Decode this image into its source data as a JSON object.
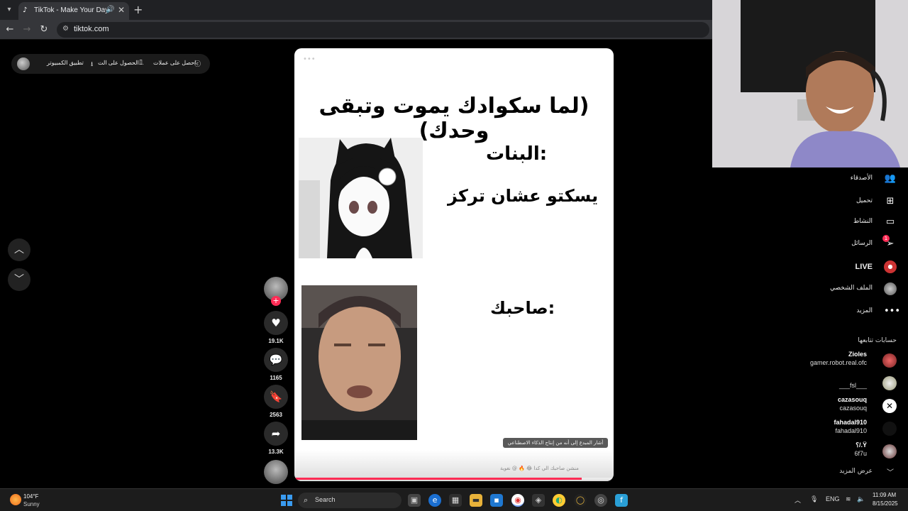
{
  "browser": {
    "tab_title": "TikTok - Make Your Day",
    "url": "tiktok.com"
  },
  "top_bar": {
    "get_coins": "احصل على عملات",
    "get_app": "الحصول على الت...",
    "desktop_app": "تطبيق الكمبيوتر"
  },
  "video": {
    "meme_title": "(لما سكوادك يموت وتبقى وحدك)",
    "girls_label": "البنات:",
    "girls_text": "يسكتو عشان تركز",
    "friend_label": "صاحبك:",
    "ai_notice": "أشار المبدع إلى أنه من إنتاج الذكاء الاصطناعي",
    "caption": "منشن صاحبك الي كدا 😂 🔥 @ نغوية",
    "progress": 0.9
  },
  "actions": {
    "likes": "19.1K",
    "comments": "1165",
    "saves": "2563",
    "shares": "13.3K"
  },
  "sidebar": {
    "friends": "الأصدقاء",
    "upload": "تحميل",
    "activity": "النشاط",
    "messages": "الرسائل",
    "messages_badge": "1",
    "live": "LIVE",
    "profile": "الملف الشخصي",
    "more": "المزيد",
    "following_heading": "حسابات تتابعها",
    "accounts": [
      {
        "name": "Zioles",
        "handle": "gamer.robot.real.ofc"
      },
      {
        "name": "",
        "handle": "___fsl___"
      },
      {
        "name": "cazasouq",
        "handle": "cazasouq"
      },
      {
        "name": "fahadal910",
        "handle": "fahadal910"
      },
      {
        "name": "؟/.Ÿ",
        "handle": "6f7u"
      }
    ],
    "show_more": "عرض المزيد"
  },
  "taskbar": {
    "temperature": "104°F",
    "weather": "Sunny",
    "search": "Search",
    "language": "ENG",
    "time": "11:09 AM",
    "date": "8/15/2025"
  },
  "colors": {
    "accent": "#fe2c55",
    "background": "#000000",
    "windows_blue": "#3a9bf0"
  }
}
